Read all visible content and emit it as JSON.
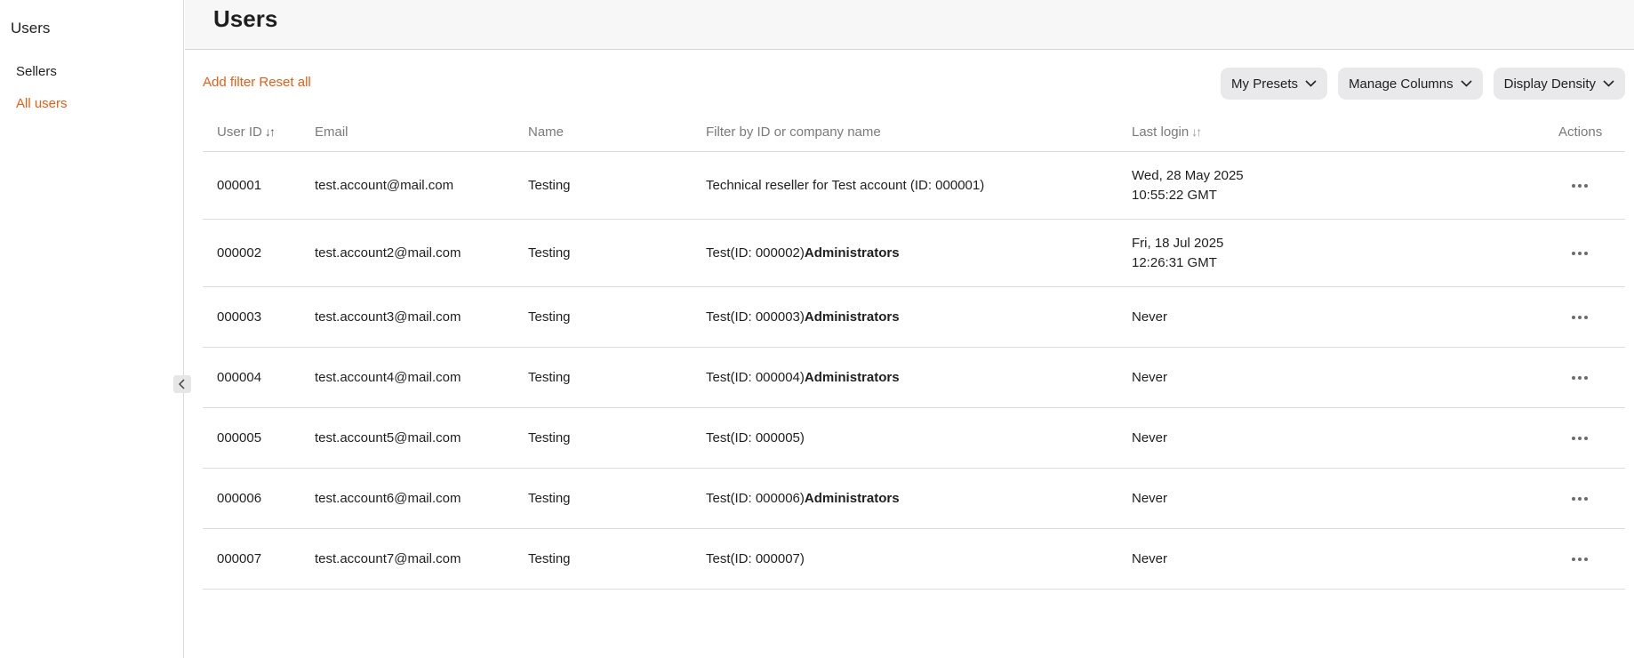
{
  "sidebar": {
    "title": "Users",
    "items": [
      {
        "label": "Sellers",
        "active": false
      },
      {
        "label": "All users",
        "active": true
      }
    ]
  },
  "header": {
    "title": "Users"
  },
  "toolbar": {
    "add_filter": "Add filter",
    "reset_all": "Reset all",
    "buttons": [
      {
        "label": "My Presets"
      },
      {
        "label": "Manage Columns"
      },
      {
        "label": "Display Density"
      }
    ]
  },
  "table": {
    "columns": {
      "user_id": "User ID",
      "email": "Email",
      "name": "Name",
      "company": "Filter by ID or company name",
      "last_login": "Last login",
      "actions": "Actions"
    },
    "rows": [
      {
        "id": "000001",
        "email": "test.account@mail.com",
        "name": "Testing",
        "company": "Technical reseller for Test account (ID: 000001)",
        "role": "",
        "login_date": "Wed, 28 May 2025",
        "login_time": "10:55:22 GMT"
      },
      {
        "id": "000002",
        "email": "test.account2@mail.com",
        "name": "Testing",
        "company": "Test(ID: 000002)",
        "role": "Administrators",
        "login_date": "Fri, 18 Jul 2025",
        "login_time": "12:26:31 GMT"
      },
      {
        "id": "000003",
        "email": "test.account3@mail.com",
        "name": "Testing",
        "company": "Test(ID: 000003)",
        "role": "Administrators",
        "login_date": "Never",
        "login_time": ""
      },
      {
        "id": "000004",
        "email": "test.account4@mail.com",
        "name": "Testing",
        "company": "Test(ID: 000004)",
        "role": "Administrators",
        "login_date": "Never",
        "login_time": ""
      },
      {
        "id": "000005",
        "email": "test.account5@mail.com",
        "name": "Testing",
        "company": "Test(ID: 000005)",
        "role": "",
        "login_date": "Never",
        "login_time": ""
      },
      {
        "id": "000006",
        "email": "test.account6@mail.com",
        "name": "Testing",
        "company": "Test(ID: 000006)",
        "role": "Administrators",
        "login_date": "Never",
        "login_time": ""
      },
      {
        "id": "000007",
        "email": "test.account7@mail.com",
        "name": "Testing",
        "company": "Test(ID: 000007)",
        "role": "",
        "login_date": "Never",
        "login_time": ""
      }
    ]
  },
  "colors": {
    "accent": "#ee5a12",
    "button_bg": "#e9e9eb",
    "header_bg": "#f7f7f7"
  },
  "icons": {
    "chevron": "chevron-down-icon",
    "sort": "sort-arrows-icon",
    "collapse": "chevron-left-icon",
    "more": "more-horizontal-icon"
  }
}
